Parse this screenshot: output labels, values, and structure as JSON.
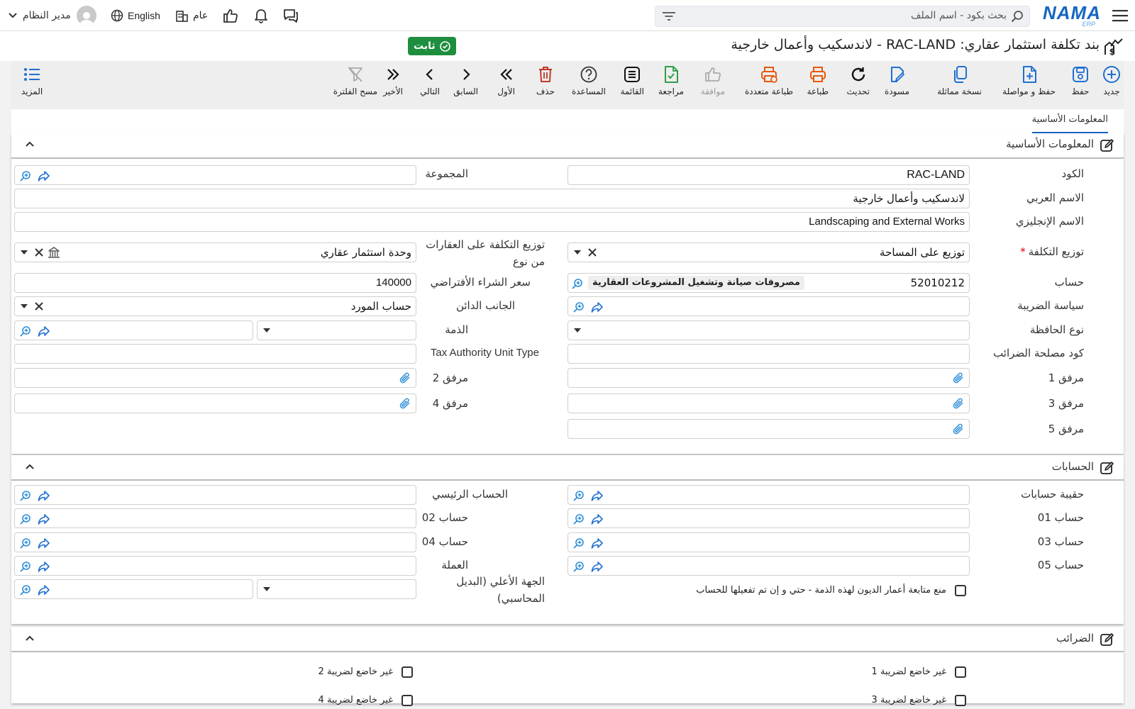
{
  "header": {
    "search_placeholder": "بحث بكود - اسم الملف",
    "user": "مدير النظام",
    "language": "English",
    "branch": "عام",
    "logo_text": "NAMA",
    "logo_sub": "ERP"
  },
  "page": {
    "title": "بند تكلفة استثمار عقاري: RAC-LAND - لاندسكيب وأعمال خارجية",
    "status": "ثابت",
    "status_color": "#1e8e3e"
  },
  "toolbar": {
    "new": "جديد",
    "save": "حفظ",
    "save_continue": "حفظ و مواصلة",
    "duplicate": "نسخة مماثلة",
    "draft": "مسودة",
    "refresh": "تحديث",
    "print": "طباعة",
    "multi_print": "طباعة متعددة",
    "approve": "موافقة",
    "review": "مراجعة",
    "list": "القائمة",
    "help": "المساعدة",
    "delete": "حذف",
    "first": "الأول",
    "previous": "السابق",
    "next": "التالي",
    "last": "الأخير",
    "clear_filter": "مسح الفلترة",
    "more": "المزيد"
  },
  "tabs": {
    "basic": "المعلومات الأساسية"
  },
  "sections": {
    "basic": "المعلومات الأساسية",
    "accounts": "الحسابات",
    "taxes": "الضرائب"
  },
  "fields": {
    "code": {
      "label": "الكود",
      "value": "RAC-LAND"
    },
    "group": {
      "label": "المجموعة",
      "value": ""
    },
    "arabic_name": {
      "label": "الاسم العربي",
      "value": "لاندسكيب وأعمال خارجية"
    },
    "english_name": {
      "label": "الاسم الإنجليزي",
      "value": "Landscaping and External Works"
    },
    "cost_distribution": {
      "label": "توزيع التكلفة",
      "value": "توزيع على المساحة"
    },
    "distribution_type": {
      "label": "توزيع التكلفة على العقارات من نوع",
      "value": "وحدة استثمار عقاري"
    },
    "account": {
      "label": "حساب",
      "code": "52010212",
      "name": "مصروفات صيانة وتشغيل المشروعات العقارية"
    },
    "default_purchase_price": {
      "label": "سعر الشراء الأفتراضي",
      "value": "140000"
    },
    "tax_policy": {
      "label": "سياسة الضريبة",
      "value": ""
    },
    "creditor_side": {
      "label": "الجانب الدائن",
      "value": "حساب المورد"
    },
    "portfolio_type": {
      "label": "نوع الحافظة",
      "value": ""
    },
    "liability": {
      "label": "الذمة",
      "value": ""
    },
    "tax_authority_code": {
      "label": "كود مصلحة الضرائب",
      "value": ""
    },
    "tax_authority_unit_type": {
      "label": "Tax Authority Unit Type",
      "value": ""
    },
    "attachment1": {
      "label": "مرفق 1"
    },
    "attachment2": {
      "label": "مرفق 2"
    },
    "attachment3": {
      "label": "مرفق 3"
    },
    "attachment4": {
      "label": "مرفق 4"
    },
    "attachment5": {
      "label": "مرفق 5"
    }
  },
  "accounts": {
    "bag": "حقيبة حسابات",
    "main": "الحساب الرئيسي",
    "acc01": "حساب 01",
    "acc02": "حساب 02",
    "acc03": "حساب 03",
    "acc04": "حساب 04",
    "acc05": "حساب 05",
    "currency": "العملة",
    "higher_entity": "الجهة الأعلي (البديل المحاسبي)",
    "prevent_aging": "منع متابعة أعمار الديون لهذه الذمة - حتي و إن تم تفعيلها للحساب"
  },
  "taxes": {
    "exempt1": "غير خاضع لضريبة 1",
    "exempt2": "غير خاضع لضريبة 2",
    "exempt3": "غير خاضع لضريبة 3",
    "exempt4": "غير خاضع لضريبة 4"
  },
  "colors": {
    "accent": "#1565c0",
    "icon_blue": "#1f6fd1",
    "icon_orange": "#e8590c",
    "icon_green": "#2e9e48",
    "icon_red": "#c0392b",
    "icon_lightblue": "#2d8ed8"
  }
}
